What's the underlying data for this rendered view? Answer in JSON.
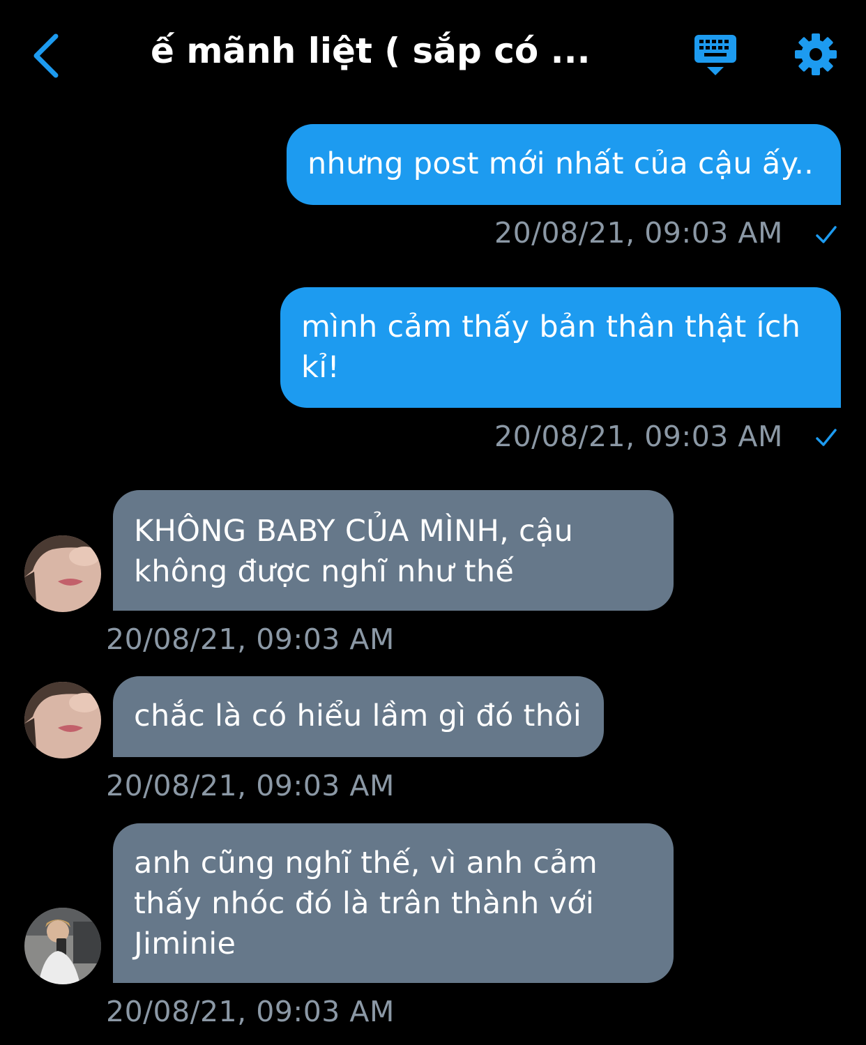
{
  "header": {
    "title": "ế mãnh liệt ( sắp có ...",
    "back_icon": "chevron-left-icon",
    "keyboard_icon": "keyboard-icon",
    "settings_icon": "gear-icon"
  },
  "colors": {
    "accent": "#1d9bf0",
    "incoming_bubble": "#66788a",
    "timestamp": "#8b98a5",
    "background": "#000000"
  },
  "messages": [
    {
      "direction": "outgoing",
      "text": "nhưng post mới nhất của cậu ấy..",
      "timestamp": "20/08/21, 09:03 AM",
      "status_icon": "check-icon"
    },
    {
      "direction": "outgoing",
      "text": "mình cảm thấy bản thân thật ích kỉ!",
      "timestamp": "20/08/21, 09:03 AM",
      "status_icon": "check-icon"
    },
    {
      "direction": "incoming",
      "text": "KHÔNG BABY CỦA MÌNH, cậu không được nghĩ như thế",
      "timestamp": "20/08/21, 09:03 AM",
      "avatar_icon": "avatar-icon"
    },
    {
      "direction": "incoming",
      "text": "chắc là có hiểu lầm gì đó thôi",
      "timestamp": "20/08/21, 09:03 AM",
      "avatar_icon": "avatar-icon"
    },
    {
      "direction": "incoming",
      "text": "anh cũng nghĩ thế, vì anh cảm thấy nhóc đó là trân thành với Jiminie",
      "timestamp": "20/08/21, 09:03 AM",
      "avatar_icon": "avatar-icon"
    }
  ]
}
